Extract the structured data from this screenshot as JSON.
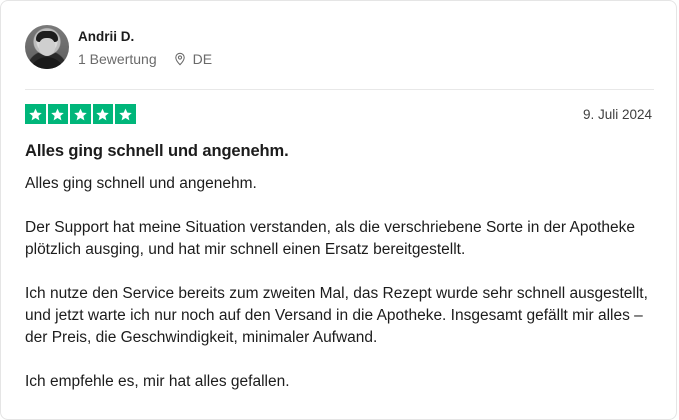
{
  "review": {
    "author_name": "Andrii D.",
    "review_count": "1 Bewertung",
    "location": "DE",
    "rating": 5,
    "max_rating": 5,
    "date": "9. Juli 2024",
    "title": "Alles ging schnell und angenehm.",
    "paragraphs": [
      "Alles ging schnell und angenehm.",
      "Der Support hat meine Situation verstanden, als die verschriebene Sorte in der Apotheke plötzlich ausging, und hat mir schnell einen Ersatz bereitgestellt.",
      "Ich nutze den Service bereits zum zweiten Mal, das Rezept wurde sehr schnell ausgestellt, und jetzt warte ich nur noch auf den Versand in die Apotheke. Insgesamt gefällt mir alles – der Preis, die Geschwindigkeit, minimaler Aufwand.",
      "Ich empfehle es, mir hat alles gefallen."
    ]
  },
  "icons": {
    "location": "map-pin-icon",
    "star": "star-icon"
  },
  "colors": {
    "star_green": "#00b67a",
    "meta_gray": "#6a6a6a",
    "text": "#1c1c1c"
  }
}
